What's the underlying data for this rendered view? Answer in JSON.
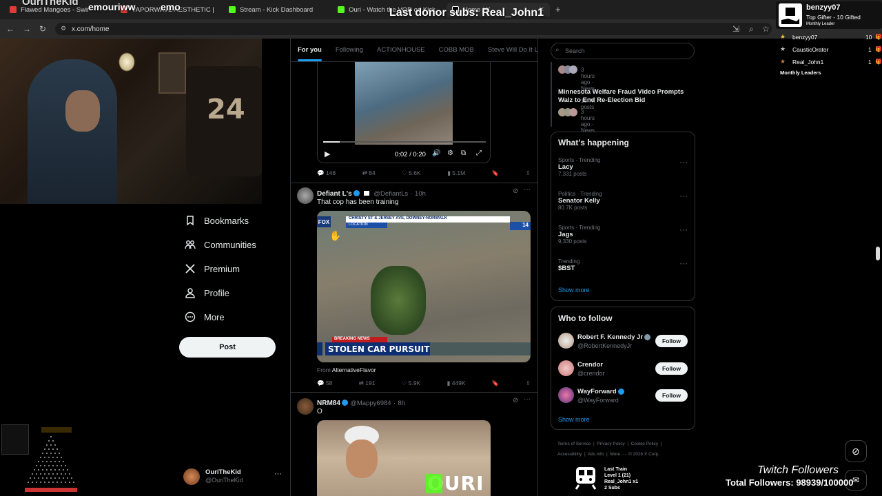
{
  "overlays": {
    "top_left_channel": "OuriTheKid",
    "top_left_user": "emouriww",
    "top_left_emo": "emo",
    "last_donor": "Last donor subs: Real_John1",
    "top_gifter_name": "benzyy07",
    "top_gifter_sub": "Top Gifter - 10 Gifted",
    "top_gifter_caption": "Monthly Leader",
    "leaders": [
      {
        "name": "benzyy07",
        "count": "10"
      },
      {
        "name": "CausticOrator",
        "count": "1"
      },
      {
        "name": "Real_John1",
        "count": "1"
      }
    ],
    "leaders_caption": "Monthly Leaders",
    "twitch_title": "Twitch Followers",
    "twitch_total": "Total Followers: 98939/100000",
    "train_title": "Last Train",
    "train_level": "Level 1  (21)",
    "train_user": "Real_John1 x1",
    "train_subs": "2 Subs",
    "webcam_jersey": "24"
  },
  "browser": {
    "tabs": [
      {
        "title": "Flawed Mangoes - Swimming",
        "color": "#e53935"
      },
      {
        "title": "VAPORWAVE AESTHETIC [EXT",
        "color": "#e53935"
      },
      {
        "title": "Stream - Kick Dashboard",
        "color": "#53fc18"
      },
      {
        "title": "Ouri - Watch the VOD on Kick",
        "color": "#53fc18"
      },
      {
        "title": "Home / X",
        "color": "#ffffff"
      }
    ],
    "url": "x.com/home"
  },
  "nav": {
    "items": [
      {
        "label": "Bookmarks",
        "icon": "bookmark-icon"
      },
      {
        "label": "Communities",
        "icon": "communities-icon"
      },
      {
        "label": "Premium",
        "icon": "x-logo-icon"
      },
      {
        "label": "Profile",
        "icon": "profile-icon"
      },
      {
        "label": "More",
        "icon": "more-circle-icon"
      }
    ],
    "post_label": "Post",
    "account_name": "OuriTheKid",
    "account_handle": "@OuriTheKid"
  },
  "feed": {
    "tabs": [
      "For you",
      "Following",
      "ACTIONHOUSE",
      "COBB MOB",
      "Steve Will Do It Loyal"
    ],
    "video1": {
      "time": "0:02 / 0:20",
      "stats": {
        "replies": "148",
        "reposts": "84",
        "likes": "5.6K",
        "views": "5.1M"
      }
    },
    "tweet2": {
      "name": "Defiant L's",
      "handle": "@DefiantLs",
      "time": "10h",
      "text": "That cop has been training",
      "news_top": "CHRISTY ST & JERSEY AVE, DOWNEY-NORWALK",
      "news_location": "LOCATION",
      "news_channel": "14",
      "breaking": "BREAKING NEWS",
      "headline": "STOLEN CAR PURSUIT",
      "from_label": "From",
      "from_account": "AlternativeFlavor",
      "stats": {
        "replies": "58",
        "reposts": "191",
        "likes": "5.9K",
        "views": "449K"
      }
    },
    "tweet3": {
      "name": "NRM84",
      "handle": "@Mappy6984",
      "time": "8h",
      "text": "O",
      "watermark": "OURI"
    }
  },
  "sidebar": {
    "search_placeholder": "Search",
    "news": [
      {
        "title": "",
        "meta": "3 hours ago · News · 10.7K posts"
      },
      {
        "title": "Minnesota Welfare Fraud Video Prompts Walz to End Re-Election Bid",
        "meta": "3 hours ago · News · 13.1K posts"
      }
    ],
    "happening_title": "What’s happening",
    "trends": [
      {
        "meta": "Sports · Trending",
        "name": "Lacy",
        "posts": "7,331 posts"
      },
      {
        "meta": "Politics · Trending",
        "name": "Senator Kelly",
        "posts": "80.7K posts"
      },
      {
        "meta": "Sports · Trending",
        "name": "Jags",
        "posts": "9,330 posts"
      },
      {
        "meta": "Trending",
        "name": "$BST",
        "posts": ""
      }
    ],
    "show_more": "Show more",
    "who_title": "Who to follow",
    "follows": [
      {
        "name": "Robert F. Kennedy Jr",
        "handle": "@RobertKennedyJr",
        "button": "Follow"
      },
      {
        "name": "Crendor",
        "handle": "@crendor",
        "button": "Follow"
      },
      {
        "name": "WayForward",
        "handle": "@WayForward",
        "button": "Follow"
      }
    ],
    "footer_line1": "Terms of Service  |  Privacy Policy  |  Cookie Policy  |",
    "footer_line2": "Accessibility  |  Ads info  |  More ···  © 2026 X Corp."
  }
}
